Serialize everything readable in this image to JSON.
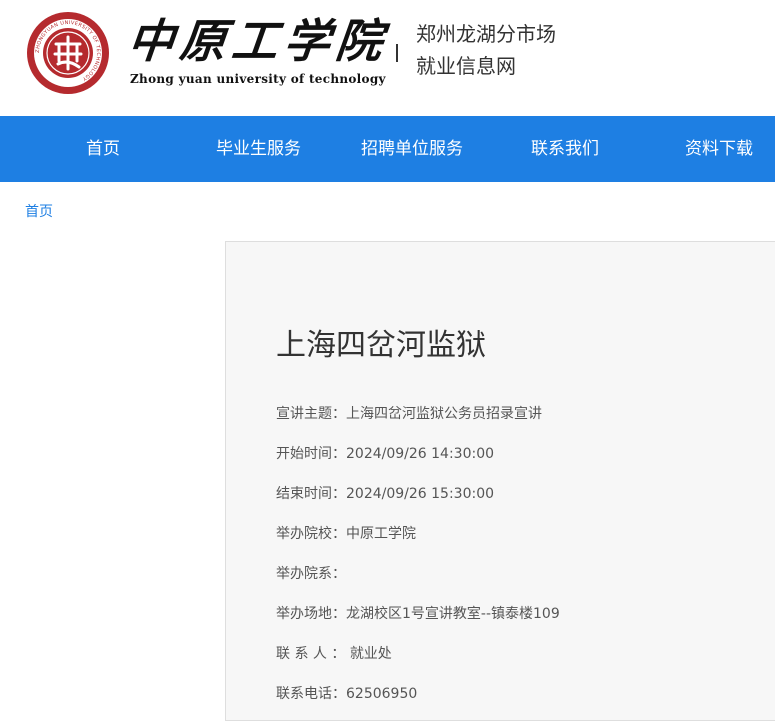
{
  "header": {
    "school_name_cn": "中原工学院",
    "school_name_en": "Zhong yuan university of technology",
    "seal_text": "ZHONGYUAN UNIVERSITY OF TECHNOLOGY",
    "site_title_line1": "郑州龙湖分市场",
    "site_title_line2": "就业信息网"
  },
  "nav": {
    "items": [
      {
        "label": "首页"
      },
      {
        "label": "毕业生服务"
      },
      {
        "label": "招聘单位服务"
      },
      {
        "label": "联系我们"
      },
      {
        "label": "资料下载"
      }
    ]
  },
  "breadcrumb": {
    "home": "首页"
  },
  "detail": {
    "title": "上海四岔河监狱",
    "rows": [
      {
        "label": "宣讲主题：",
        "value": "上海四岔河监狱公务员招录宣讲"
      },
      {
        "label": "开始时间：",
        "value": "2024/09/26 14:30:00"
      },
      {
        "label": "结束时间：",
        "value": "2024/09/26 15:30:00"
      },
      {
        "label": "举办院校：",
        "value": "中原工学院"
      },
      {
        "label": "举办院系：",
        "value": ""
      },
      {
        "label": "举办场地：",
        "value": "龙湖校区1号宣讲教室--镇泰楼109"
      },
      {
        "label": "联 系 人 ：",
        "value": "就业处"
      },
      {
        "label": "联系电话：",
        "value": "62506950"
      }
    ]
  },
  "colors": {
    "nav_bg": "#1e7fe3",
    "seal_red": "#b52a2e"
  }
}
